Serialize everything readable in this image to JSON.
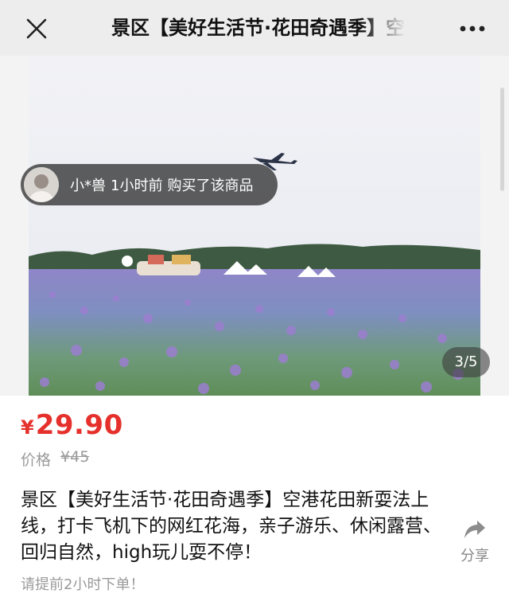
{
  "navbar": {
    "title": "景区【美好生活节·花田奇遇季】空港花田新耍法上线",
    "close_icon": "close-icon",
    "more_icon": "more-dots-icon"
  },
  "gallery": {
    "purchase_notice": {
      "user": "小*兽",
      "time": "1小时前",
      "action": "购买了该商品"
    },
    "page_counter": "3/5"
  },
  "price": {
    "currency": "¥",
    "value": "29.90",
    "color": "#e5302c"
  },
  "original_price": {
    "label": "价格",
    "value": "¥45"
  },
  "product": {
    "title": "景区【美好生活节·花田奇遇季】空港花田新耍法上线，打卡飞机下的网红花海，亲子游乐、休闲露营、回归自然，high玩儿耍不停！",
    "notice": "请提前2小时下单！"
  },
  "share": {
    "label": "分享",
    "icon": "share-arrow-icon"
  }
}
